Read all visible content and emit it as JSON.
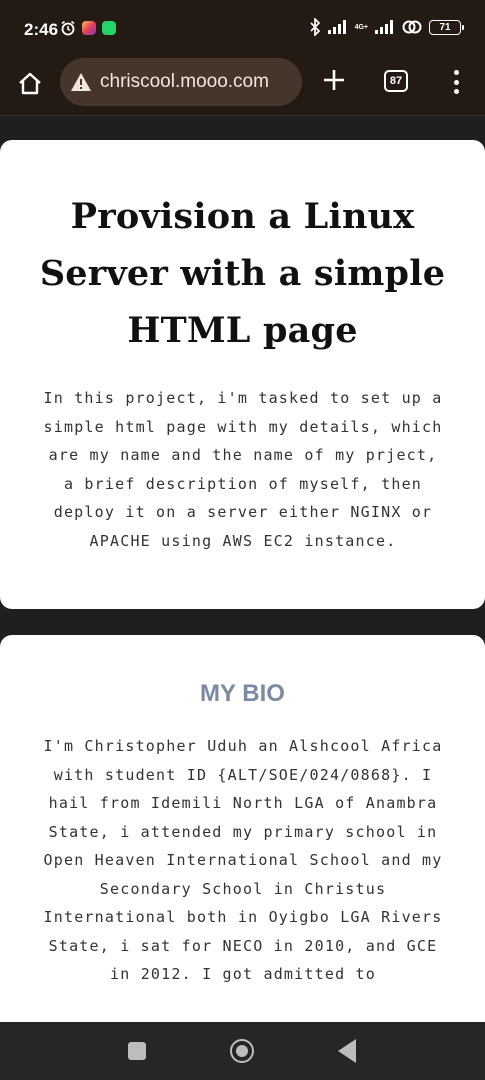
{
  "status_bar": {
    "time": "2:46",
    "network_label": "4G+",
    "battery": "71",
    "icons": [
      "alarm-icon",
      "instagram-icon",
      "whatsapp-icon",
      "bluetooth-icon",
      "signal-icon",
      "signal-icon",
      "hotspot-icon",
      "battery-icon"
    ]
  },
  "browser": {
    "url": "chriscool.mooo.com",
    "tab_count": "87",
    "icons": [
      "home-icon",
      "warning-icon",
      "plus-icon",
      "tabs-icon",
      "more-vert-icon"
    ]
  },
  "card1": {
    "title": "Provision a Linux Server with a simple HTML page",
    "intro": "In this project, i'm tasked to set up a simple html page with my details, which are my name and the name of my prject, a brief description of myself, then deploy it on a server either NGINX or APACHE using AWS EC2 instance."
  },
  "card2": {
    "heading": "MY BIO",
    "text": "I'm Christopher Uduh an Alshcool Africa with student ID {ALT/SOE/024/0868}. I hail from Idemili North LGA of Anambra State, i attended my primary school in Open Heaven International School and my Secondary School in Christus International both in Oyigbo LGA Rivers State, i sat for NECO in 2010, and GCE in 2012. I got admitted to"
  },
  "nav_bar": {
    "icons": [
      "recents-icon",
      "home-icon",
      "back-icon"
    ]
  },
  "colors": {
    "chrome_bg": "#241a14",
    "url_bar_bg": "#46352a",
    "page_bg": "#1f1f1f",
    "card_bg": "#ffffff",
    "bio_heading": "#7a8aa0"
  }
}
